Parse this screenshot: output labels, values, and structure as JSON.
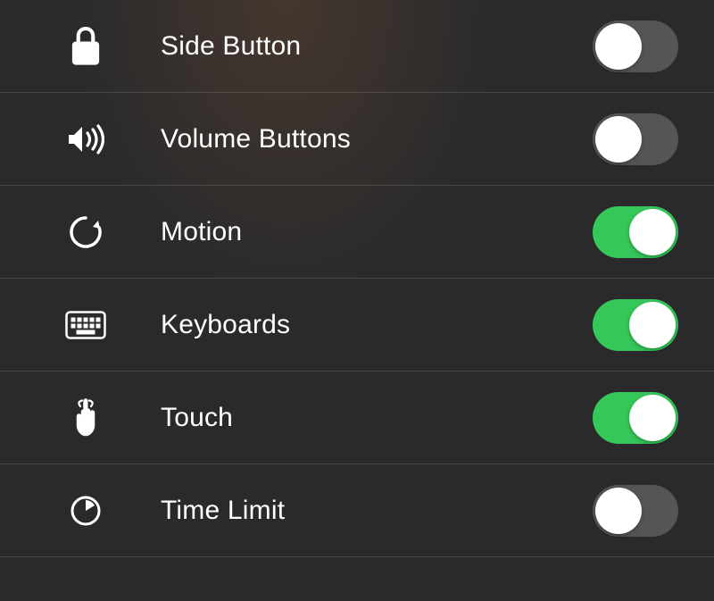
{
  "settings": {
    "rows": [
      {
        "id": "side-button",
        "label": "Side Button",
        "icon": "lock-icon",
        "on": false
      },
      {
        "id": "volume-buttons",
        "label": "Volume Buttons",
        "icon": "speaker-icon",
        "on": false
      },
      {
        "id": "motion",
        "label": "Motion",
        "icon": "rotate-icon",
        "on": true
      },
      {
        "id": "keyboards",
        "label": "Keyboards",
        "icon": "keyboard-icon",
        "on": true
      },
      {
        "id": "touch",
        "label": "Touch",
        "icon": "hand-icon",
        "on": true
      },
      {
        "id": "time-limit",
        "label": "Time Limit",
        "icon": "timer-icon",
        "on": false
      }
    ]
  },
  "colors": {
    "toggle_on": "#34c759",
    "toggle_off": "#555558",
    "background": "#2a2a2c",
    "text": "#ffffff"
  }
}
